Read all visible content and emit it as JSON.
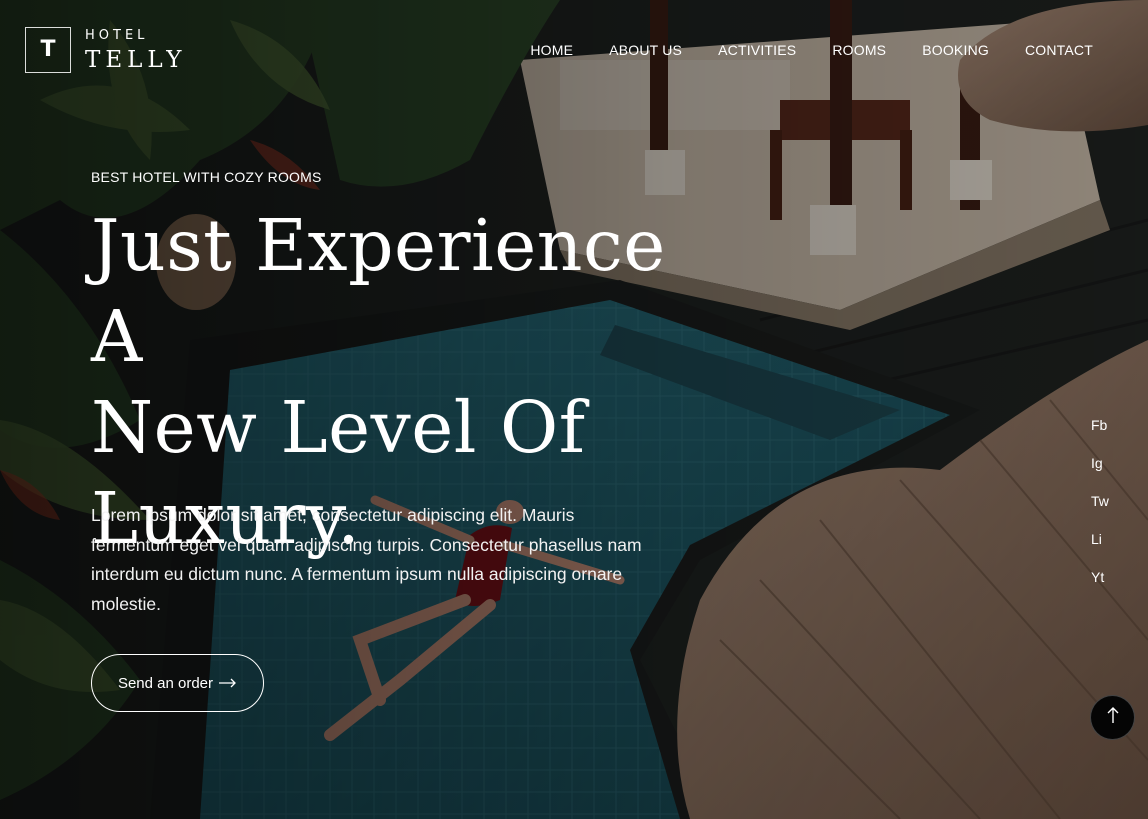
{
  "logo": {
    "mark": "T",
    "small": "HOTEL",
    "big": "TELLY"
  },
  "nav": {
    "items": [
      "HOME",
      "ABOUT US",
      "ACTIVITIES",
      "ROOMS",
      "BOOKING",
      "CONTACT"
    ]
  },
  "hero": {
    "eyebrow": "BEST HOTEL WITH COZY ROOMS",
    "headline_lines": [
      "Just Experience A",
      "New Level Of",
      "Luxury."
    ],
    "description": "Lorem ipsum dolor sit amet, consectetur adipiscing elit. Mauris fermentum eget vel quam adipiscing turpis. Consectetur phasellus nam interdum eu dictum nunc. A fermentum ipsum nulla adipiscing ornare molestie.",
    "cta_label": "Send an order"
  },
  "social": [
    "Fb",
    "Ig",
    "Tw",
    "Li",
    "Yt"
  ],
  "icons": {
    "cta": "arrow-right-icon",
    "scroll_top": "arrow-up-icon"
  },
  "colors": {
    "pool": "#1f5f6e",
    "deck": "#2a2a2a",
    "thatch": "#8b6f5a",
    "foliage": "#2f4a2e",
    "overlay": "#000000"
  }
}
